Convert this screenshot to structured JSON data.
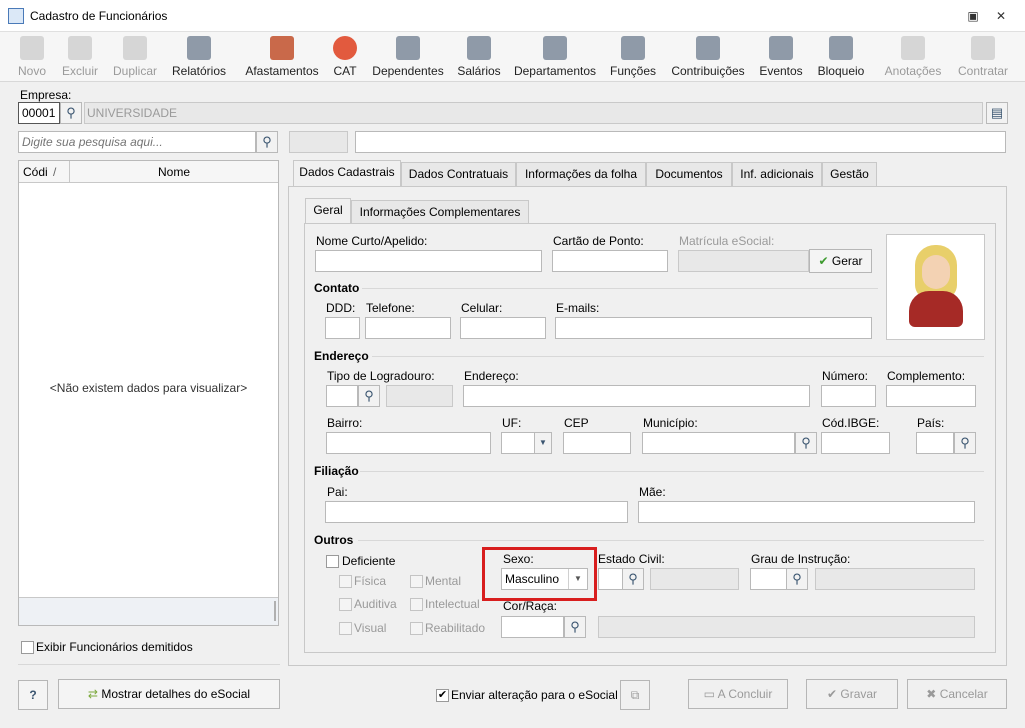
{
  "window": {
    "title": "Cadastro de Funcionários"
  },
  "toolbar": {
    "novo": "Novo",
    "excluir": "Excluir",
    "duplicar": "Duplicar",
    "relatorios": "Relatórios",
    "afastamentos": "Afastamentos",
    "cat": "CAT",
    "dependentes": "Dependentes",
    "salarios": "Salários",
    "departamentos": "Departamentos",
    "funcoes": "Funções",
    "contribuicoes": "Contribuições",
    "eventos": "Eventos",
    "bloqueio": "Bloqueio",
    "anotacoes": "Anotações",
    "contratar": "Contratar"
  },
  "empresa": {
    "label": "Empresa:",
    "code": "00001",
    "name": "UNIVERSIDADE"
  },
  "search": {
    "placeholder": "Digite sua pesquisa aqui..."
  },
  "grid": {
    "col_code": "Códi",
    "col_name": "Nome",
    "empty": "<Não existem dados para visualizar>"
  },
  "exibir_demitidos": "Exibir Funcionários demitidos",
  "tabs": [
    "Dados Cadastrais",
    "Dados Contratuais",
    "Informações da folha",
    "Documentos",
    "Inf. adicionais",
    "Gestão"
  ],
  "subtabs": [
    "Geral",
    "Informações Complementares"
  ],
  "form": {
    "nome_curto": "Nome Curto/Apelido:",
    "cartao_ponto": "Cartão de Ponto:",
    "matricula": "Matrícula eSocial:",
    "gerar": "Gerar",
    "contato": "Contato",
    "ddd": "DDD:",
    "telefone": "Telefone:",
    "celular": "Celular:",
    "emails": "E-mails:",
    "endereco_sec": "Endereço",
    "tipo_logradouro": "Tipo de Logradouro:",
    "endereco": "Endereço:",
    "numero": "Número:",
    "complemento": "Complemento:",
    "bairro": "Bairro:",
    "uf": "UF:",
    "cep": "CEP",
    "municipio": "Município:",
    "cod_ibge": "Cód.IBGE:",
    "pais": "País:",
    "filiacao": "Filiação",
    "pai": "Pai:",
    "mae": "Mãe:",
    "outros": "Outros",
    "deficiente": "Deficiente",
    "fisica": "Física",
    "mental": "Mental",
    "auditiva": "Auditiva",
    "intelectual": "Intelectual",
    "visual": "Visual",
    "reabilitado": "Reabilitado",
    "sexo": "Sexo:",
    "sexo_value": "Masculino",
    "estado_civil": "Estado Civil:",
    "grau_instrucao": "Grau de Instrução:",
    "cor_raca": "Cor/Raça:"
  },
  "footer": {
    "help": "?",
    "esocial_details": "Mostrar detalhes do eSocial",
    "enviar": "Enviar alteração para o eSocial",
    "concluir": "A Concluir",
    "gravar": "Gravar",
    "cancelar": "Cancelar"
  },
  "colors": {
    "highlight": "#d81e1e",
    "accent": "#3a5570"
  }
}
